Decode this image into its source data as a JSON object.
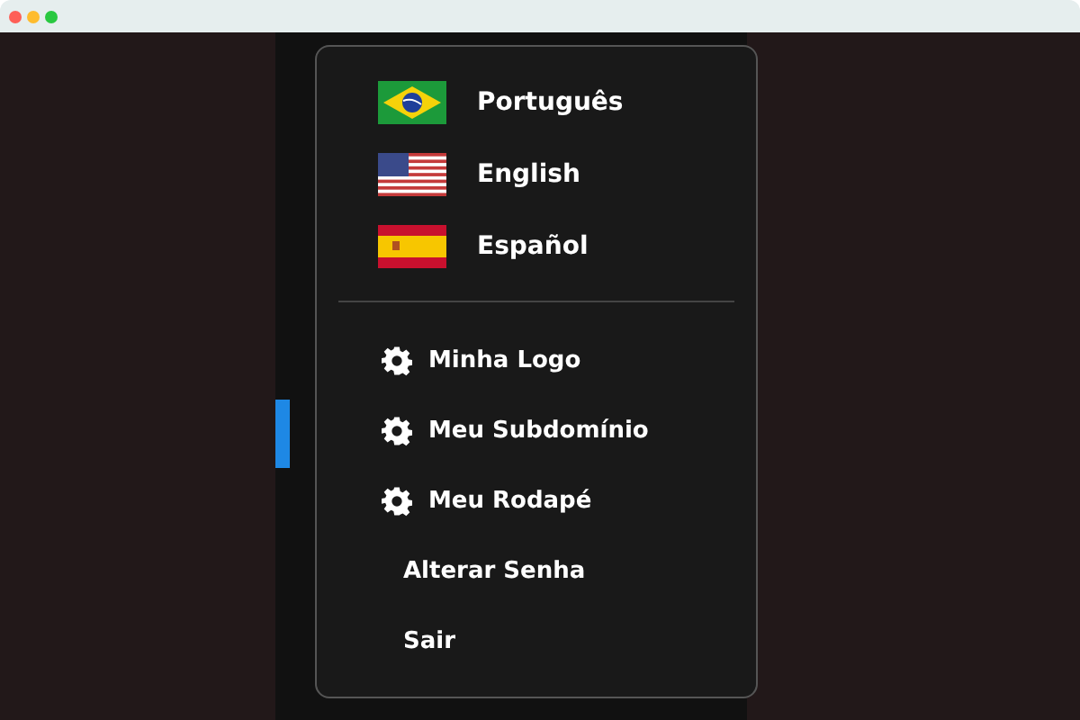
{
  "languages": [
    {
      "label": "Português",
      "kind": "br"
    },
    {
      "label": "English",
      "kind": "us"
    },
    {
      "label": "Español",
      "kind": "es"
    }
  ],
  "items": [
    {
      "label": "Minha Logo",
      "kind": "settings"
    },
    {
      "label": "Meu Subdomínio",
      "kind": "settings"
    },
    {
      "label": "Meu Rodapé",
      "kind": "settings"
    },
    {
      "label": "Alterar Senha",
      "kind": "plain"
    },
    {
      "label": "Sair",
      "kind": "plain"
    }
  ]
}
